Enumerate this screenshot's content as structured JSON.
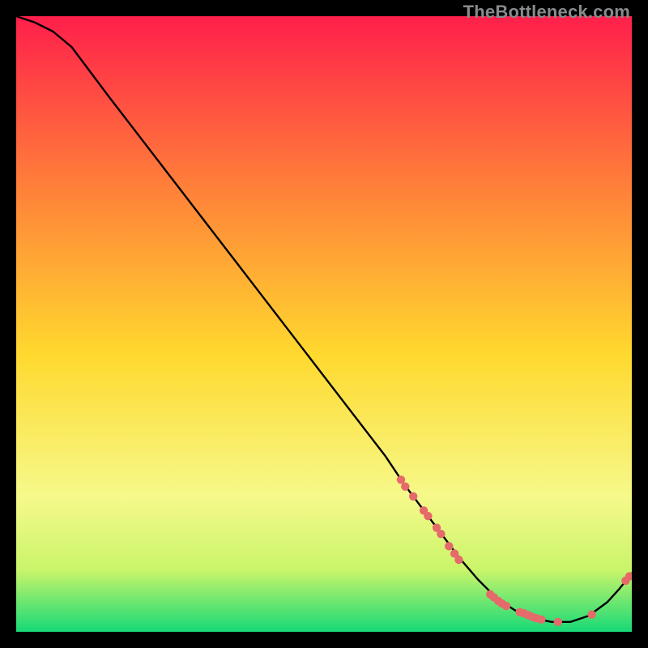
{
  "watermark": "TheBottleneck.com",
  "colors": {
    "top": "#ff1f4b",
    "mid_upper": "#ff7a3a",
    "mid": "#ffd92e",
    "mid_lower": "#f6f98a",
    "lower": "#c9f56a",
    "bottom": "#16d977",
    "curve": "#000000",
    "marker": "#e56a6a",
    "frame": "#000000"
  },
  "chart_data": {
    "type": "line",
    "title": "",
    "xlabel": "",
    "ylabel": "",
    "xlim": [
      0,
      100
    ],
    "ylim": [
      0,
      100
    ],
    "series": [
      {
        "name": "bottleneck-curve",
        "x": [
          0,
          3,
          6,
          9,
          12,
          15,
          20,
          25,
          30,
          35,
          40,
          45,
          50,
          55,
          60,
          63,
          66,
          69,
          72,
          75,
          78,
          81,
          84,
          87,
          90,
          93,
          96,
          98,
          100
        ],
        "y": [
          100,
          99,
          97.5,
          95,
          91,
          87,
          80.5,
          74,
          67.5,
          61,
          54.5,
          48,
          41.5,
          35,
          28.5,
          24,
          20,
          16,
          12,
          8.5,
          5.5,
          3.5,
          2.2,
          1.6,
          1.6,
          2.6,
          4.8,
          7.0,
          9.5
        ]
      }
    ],
    "markers": [
      {
        "x": 62.5,
        "y": 24.7
      },
      {
        "x": 63.2,
        "y": 23.6
      },
      {
        "x": 64.5,
        "y": 22.0
      },
      {
        "x": 66.2,
        "y": 19.7
      },
      {
        "x": 66.9,
        "y": 18.8
      },
      {
        "x": 68.3,
        "y": 16.9
      },
      {
        "x": 69.0,
        "y": 15.9
      },
      {
        "x": 70.3,
        "y": 13.9
      },
      {
        "x": 71.2,
        "y": 12.7
      },
      {
        "x": 71.9,
        "y": 11.7
      },
      {
        "x": 77.0,
        "y": 6.1
      },
      {
        "x": 77.6,
        "y": 5.6
      },
      {
        "x": 78.3,
        "y": 5.0
      },
      {
        "x": 78.9,
        "y": 4.6
      },
      {
        "x": 79.6,
        "y": 4.2
      },
      {
        "x": 81.8,
        "y": 3.2
      },
      {
        "x": 82.5,
        "y": 3.0
      },
      {
        "x": 83.2,
        "y": 2.7
      },
      {
        "x": 83.9,
        "y": 2.4
      },
      {
        "x": 84.5,
        "y": 2.2
      },
      {
        "x": 85.3,
        "y": 2.0
      },
      {
        "x": 88.0,
        "y": 1.6
      },
      {
        "x": 93.5,
        "y": 2.8
      },
      {
        "x": 99.0,
        "y": 8.3
      },
      {
        "x": 99.6,
        "y": 9.0
      }
    ]
  }
}
